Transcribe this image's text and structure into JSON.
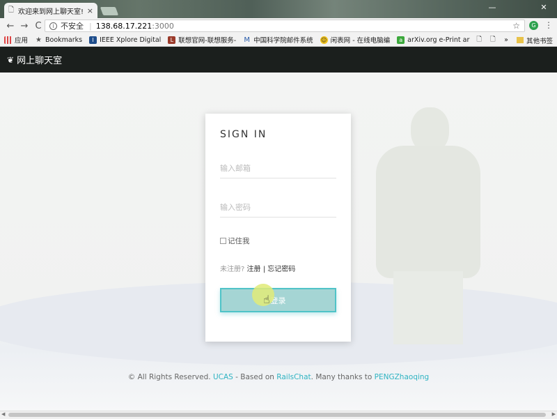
{
  "browser": {
    "tab_title": "欢迎来到网上聊天室!",
    "tab_close": "×",
    "minimize": "—",
    "close": "✕",
    "insecure_label": "不安全",
    "url_host": "138.68.17.221",
    "url_port": ":3000",
    "nav_back": "←",
    "nav_forward": "→",
    "nav_reload": "C",
    "bookmark_star": "☆",
    "kebab": "⋮",
    "bookmarks": [
      {
        "label": "应用",
        "icon": "apps-icon"
      },
      {
        "label": "Bookmarks",
        "icon": "star-icon"
      },
      {
        "label": "IEEE Xplore Digital",
        "icon": "ieee-icon"
      },
      {
        "label": "联想官网-联想服务-",
        "icon": "lenovo-icon"
      },
      {
        "label": "中国科学院邮件系统",
        "icon": "mail-icon"
      },
      {
        "label": "闲表网 - 在线电脑编",
        "icon": "smile-icon"
      },
      {
        "label": "arXiv.org e-Print ar",
        "icon": "arxiv-icon"
      }
    ],
    "bookmarks_more": "»",
    "other_bookmarks": "其他书签"
  },
  "navbar": {
    "brand": "网上聊天室",
    "icon": "leaf-icon"
  },
  "login": {
    "title": "SIGN IN",
    "email_placeholder": "输入邮箱",
    "password_placeholder": "输入密码",
    "remember_label": "记住我",
    "not_registered": "未注册?",
    "register_link": "注册",
    "divider": "|",
    "forgot_link": "忘记密码",
    "submit_label": "登录"
  },
  "footer": {
    "prefix": "© All Rights Reserved.",
    "ucas": "UCAS",
    "mid": "- Based on",
    "railschat": "RailsChat",
    "thanks": ". Many thanks to",
    "author": "PENGZhaoqing"
  },
  "colors": {
    "accent": "#4fc3c7",
    "navbar": "#1b1f1d",
    "link": "#2fb3c2"
  }
}
